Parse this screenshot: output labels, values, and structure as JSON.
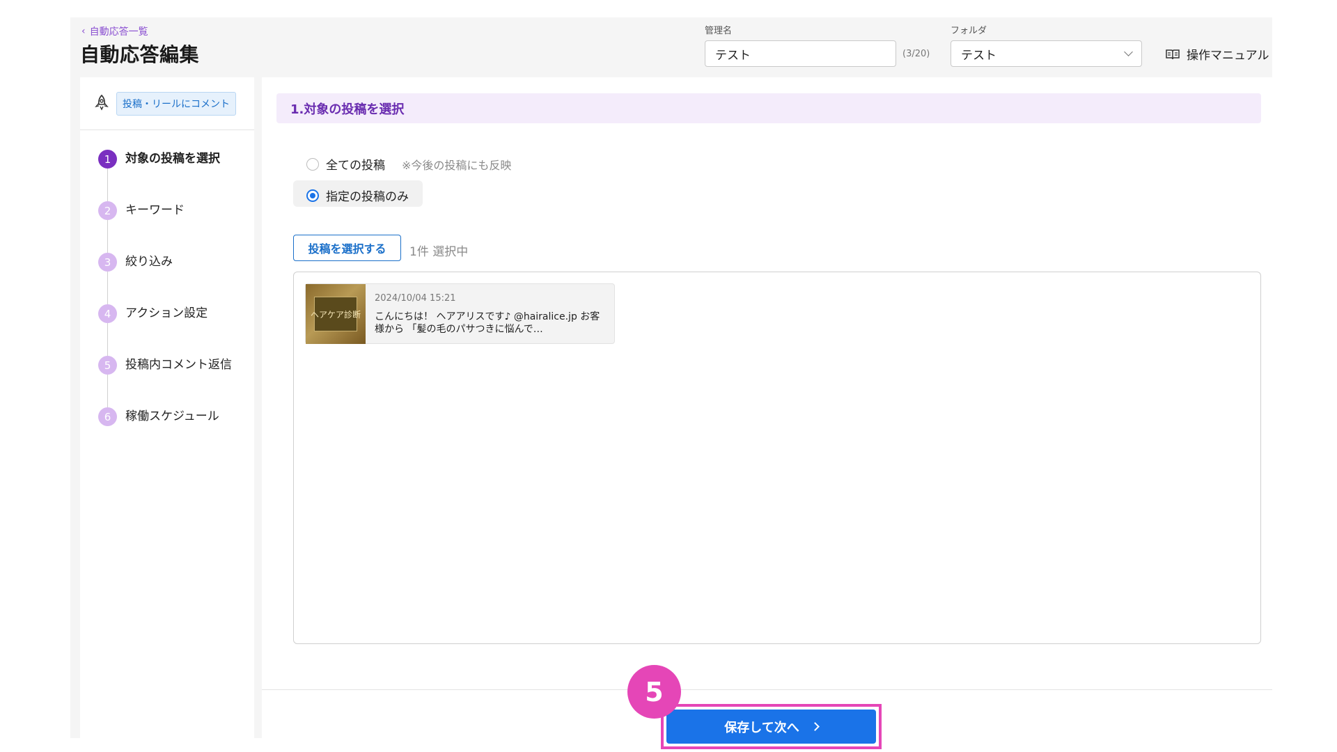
{
  "header": {
    "back_label": "自動応答一覧",
    "title": "自動応答編集",
    "name_label": "管理名",
    "name_value": "テスト",
    "name_counter": "(3/20)",
    "folder_label": "フォルダ",
    "folder_value": "テスト",
    "manual_label": "操作マニュアル"
  },
  "sidebar": {
    "type_chip": "投稿・リールにコメント",
    "steps": [
      {
        "num": "1",
        "label": "対象の投稿を選択"
      },
      {
        "num": "2",
        "label": "キーワード"
      },
      {
        "num": "3",
        "label": "絞り込み"
      },
      {
        "num": "4",
        "label": "アクション設定"
      },
      {
        "num": "5",
        "label": "投稿内コメント返信"
      },
      {
        "num": "6",
        "label": "稼働スケジュール"
      }
    ]
  },
  "main": {
    "section_title": "1.対象の投稿を選択",
    "radio_all": "全ての投稿",
    "radio_all_note": "※今後の投稿にも反映",
    "radio_specific": "指定の投稿のみ",
    "select_button": "投稿を選択する",
    "select_count": "1件 選択中",
    "post": {
      "thumb_text": "ヘアケア診断",
      "date": "2024/10/04 15:21",
      "text": "こんにちは！ ヘアアリスです♪ @hairalice.jp お客様から 「髪の毛のパサつきに悩んで…"
    },
    "save_button": "保存して次へ",
    "annotation_number": "5"
  },
  "colors": {
    "accent_purple": "#7a2fc0",
    "primary_blue": "#1a73e8",
    "highlight_pink": "#e546b7"
  }
}
